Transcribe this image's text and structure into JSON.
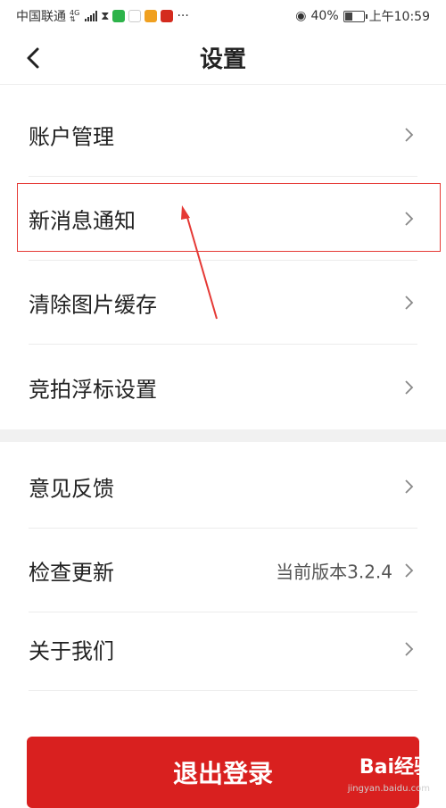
{
  "status_bar": {
    "carrier": "中国联通",
    "network": "4G",
    "battery": "40%",
    "battery_level": 0.4,
    "time": "上午10:59"
  },
  "header": {
    "title": "设置"
  },
  "sections": [
    {
      "items": [
        {
          "label": "账户管理"
        },
        {
          "label": "新消息通知"
        },
        {
          "label": "清除图片缓存"
        },
        {
          "label": "竞拍浮标设置"
        }
      ]
    },
    {
      "items": [
        {
          "label": "意见反馈"
        },
        {
          "label": "检查更新",
          "value": "当前版本3.2.4"
        },
        {
          "label": "关于我们"
        }
      ]
    }
  ],
  "logout_label": "退出登录",
  "watermark": {
    "text": "Bai经验",
    "sub": "jingyan.baidu.com"
  },
  "colors": {
    "accent": "#d9201f",
    "annotation": "#e53935"
  }
}
